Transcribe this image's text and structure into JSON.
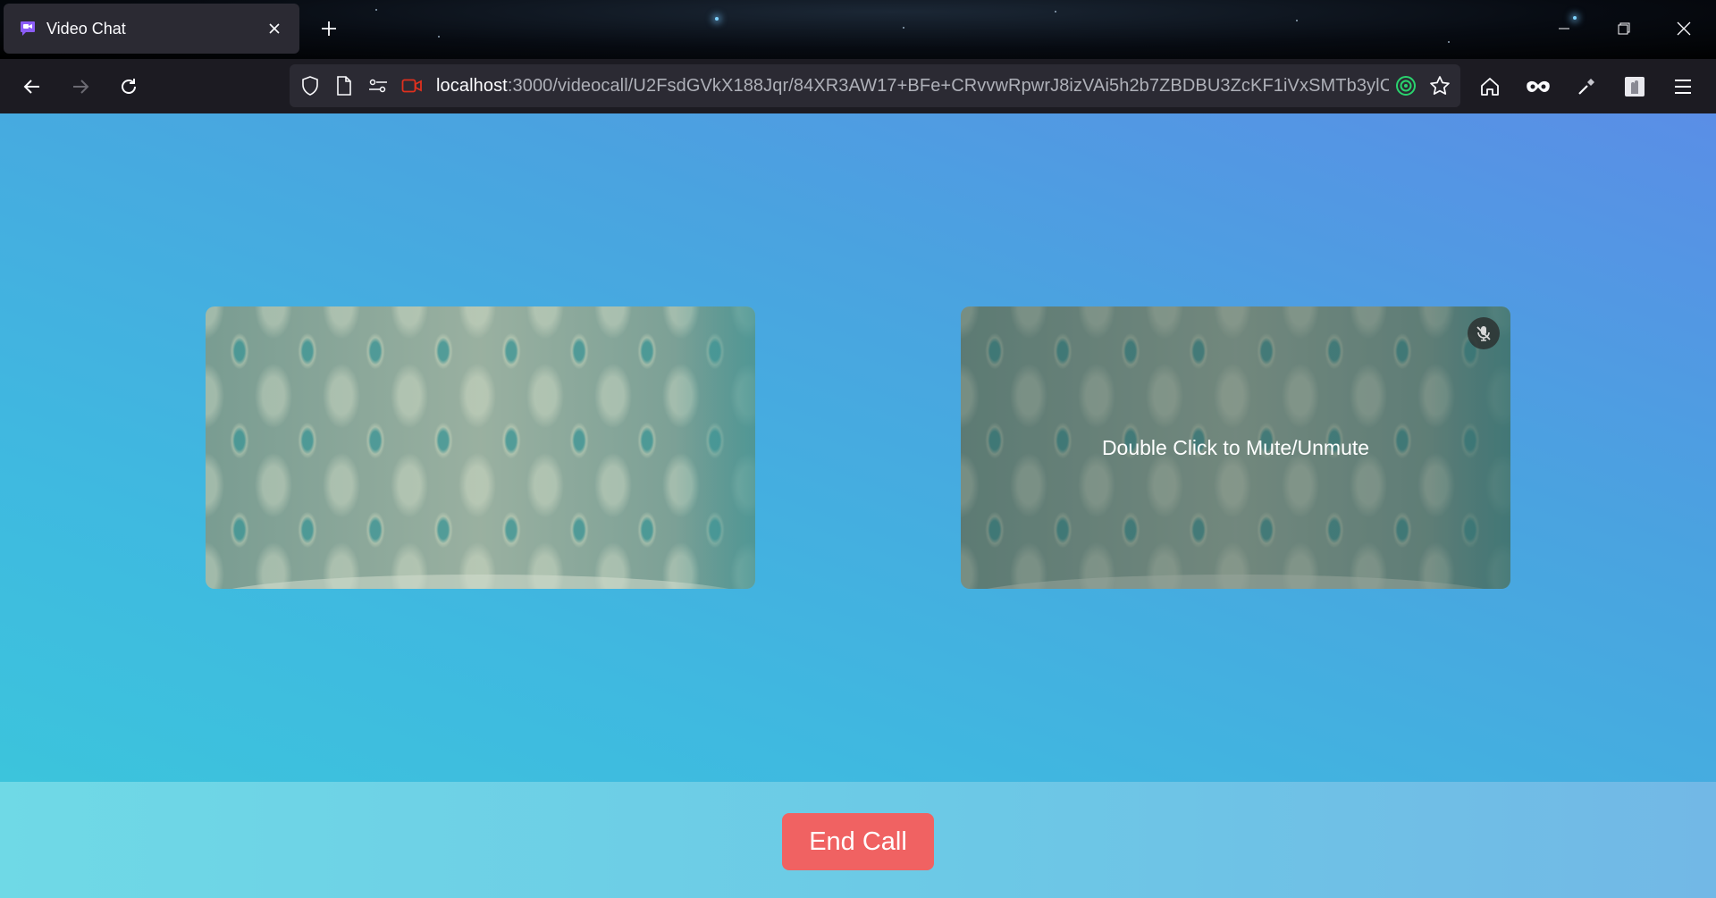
{
  "browser": {
    "tab": {
      "title": "Video Chat"
    },
    "url": {
      "host": "localhost",
      "path": ":3000/videocall/U2FsdGVkX188Jqr/84XR3AW17+BFe+CRvvwRpwrJ8izVAi5h2b7ZBDBU3ZcKF1iVxSMTb3ylC"
    }
  },
  "colors": {
    "accent_end_call": "#f06262",
    "tab_bg": "#2b2a33",
    "toolbar_bg": "#1c1b22",
    "camera_indicator": "#e0301e",
    "tracking_indicator": "#2ad36e"
  },
  "call": {
    "remote_overlay_text": "Double Click to Mute/Unmute",
    "end_call_label": "End Call",
    "remote_muted": true
  },
  "icons": {
    "tab": "video-chat-favicon",
    "toolbar": [
      "back-icon",
      "forward-icon",
      "reload-icon",
      "shield-icon",
      "page-icon",
      "permissions-icon",
      "camera-icon",
      "tracking-icon",
      "bookmark-star-icon",
      "home-icon",
      "mask-icon",
      "eyedropper-icon",
      "extension-icon",
      "menu-icon"
    ]
  }
}
